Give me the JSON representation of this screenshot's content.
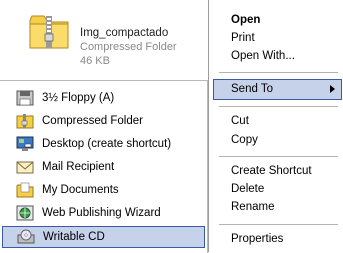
{
  "file": {
    "name": "Img_compactado",
    "type": "Compressed Folder",
    "size": "46 KB"
  },
  "send_to_menu": {
    "items": [
      {
        "label": "3½ Floppy (A)",
        "icon": "floppy-disk-icon"
      },
      {
        "label": "Compressed Folder",
        "icon": "zip-folder-icon"
      },
      {
        "label": "Desktop (create shortcut)",
        "icon": "desktop-icon"
      },
      {
        "label": "Mail Recipient",
        "icon": "mail-icon"
      },
      {
        "label": "My Documents",
        "icon": "documents-folder-icon"
      },
      {
        "label": "Web Publishing Wizard",
        "icon": "web-publish-icon"
      },
      {
        "label": "Writable CD",
        "icon": "cd-drive-icon",
        "highlighted": true
      }
    ]
  },
  "context_menu": {
    "open": "Open",
    "print": "Print",
    "open_with": "Open With...",
    "send_to": "Send To",
    "cut": "Cut",
    "copy": "Copy",
    "create_shortcut": "Create Shortcut",
    "delete": "Delete",
    "rename": "Rename",
    "properties": "Properties"
  },
  "colors": {
    "highlight_bg": "#c6d2ea",
    "highlight_border": "#3a5aa6"
  }
}
